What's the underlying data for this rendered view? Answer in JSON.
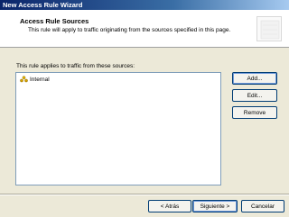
{
  "window": {
    "title": "New Access Rule Wizard"
  },
  "header": {
    "title": "Access Rule Sources",
    "subtitle": "This rule will apply to traffic originating from the sources specified in this page.",
    "icon": "wizard-icon"
  },
  "main": {
    "label": "This rule applies to traffic from these sources:",
    "sources": [
      {
        "name": "Internal",
        "icon": "network-icon"
      }
    ]
  },
  "side_buttons": {
    "add": "Add...",
    "edit": "Edit...",
    "remove": "Remove"
  },
  "footer": {
    "back": "< Atrás",
    "next": "Siguiente >",
    "cancel": "Cancelar"
  },
  "colors": {
    "titlebar_start": "#0a246a",
    "titlebar_end": "#a6caf0",
    "dialog_bg": "#ece9d8",
    "header_bg": "#ffffff"
  }
}
